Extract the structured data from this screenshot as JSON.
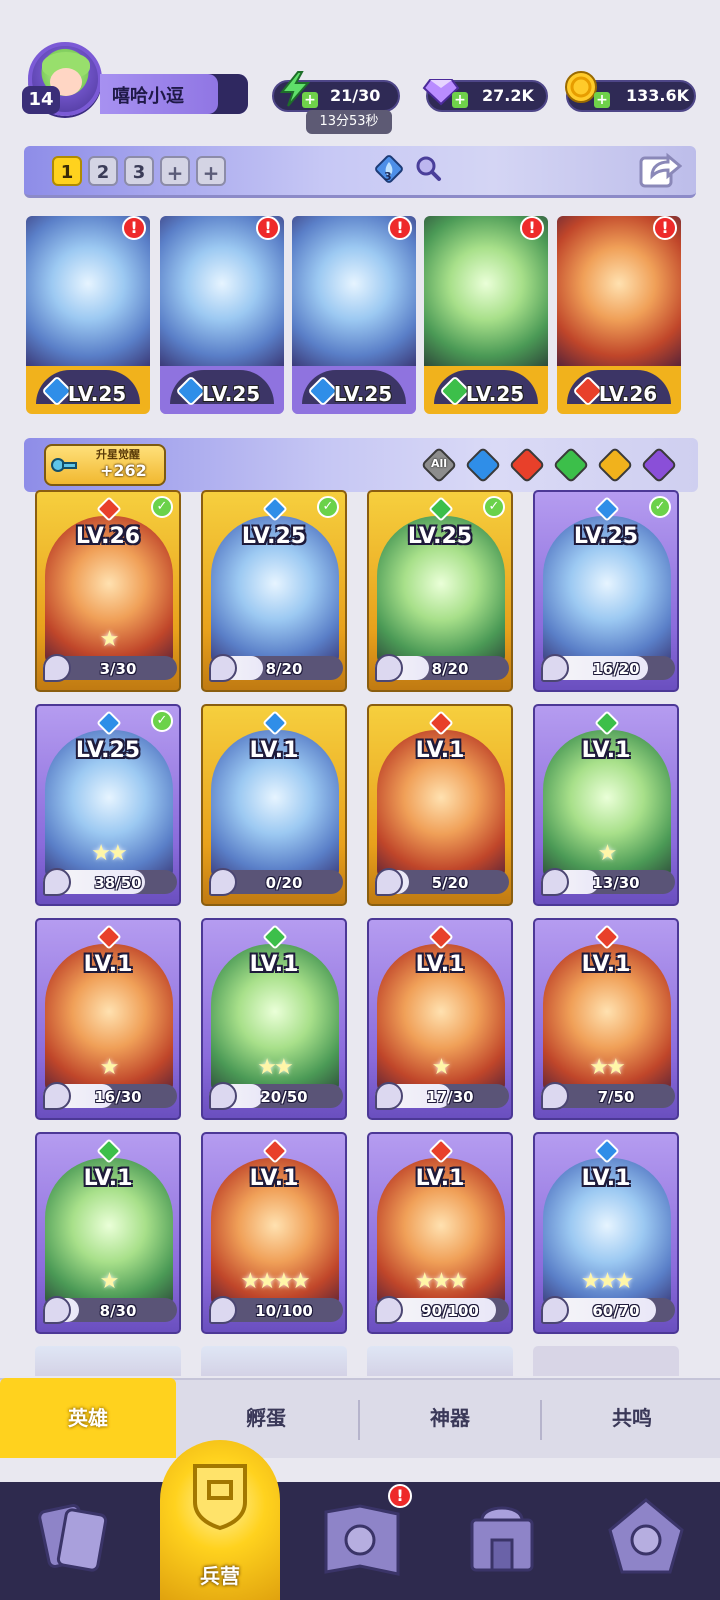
{
  "player": {
    "name": "嘻哈小逗",
    "level": "14"
  },
  "resources": {
    "energy": "21/30",
    "energy_timer": "13分53秒",
    "gems": "27.2K",
    "coins": "133.6K"
  },
  "team_tabs": [
    "1",
    "2",
    "3",
    "+",
    "+"
  ],
  "element_resonance_count": "3",
  "team": [
    {
      "level": "LV.25",
      "element": "water",
      "frame": "gold"
    },
    {
      "level": "LV.25",
      "element": "water",
      "frame": "purple"
    },
    {
      "level": "LV.25",
      "element": "water",
      "frame": "purple"
    },
    {
      "level": "LV.25",
      "element": "wind",
      "frame": "gold"
    },
    {
      "level": "LV.26",
      "element": "fire",
      "frame": "gold"
    }
  ],
  "awaken": {
    "title": "升星觉醒",
    "count": "+262"
  },
  "filters": [
    {
      "name": "all",
      "label": "All"
    },
    {
      "name": "water"
    },
    {
      "name": "fire"
    },
    {
      "name": "wind"
    },
    {
      "name": "light"
    },
    {
      "name": "dark"
    }
  ],
  "colors": {
    "water": "#2f8ee8",
    "fire": "#e8402a",
    "wind": "#3cbf4a",
    "light": "#f1b21c",
    "dark": "#8a4fd8"
  },
  "heroes": [
    {
      "level": "LV.26",
      "element": "fire",
      "frame": "gold",
      "stars": "★",
      "progress": "3/30",
      "checked": true
    },
    {
      "level": "LV.25",
      "element": "water",
      "frame": "gold",
      "stars": "",
      "progress": "8/20",
      "checked": true
    },
    {
      "level": "LV.25",
      "element": "wind",
      "frame": "gold",
      "stars": "",
      "progress": "8/20",
      "checked": true
    },
    {
      "level": "LV.25",
      "element": "water",
      "frame": "purple",
      "stars": "",
      "progress": "16/20",
      "checked": true
    },
    {
      "level": "LV.25",
      "element": "water",
      "frame": "purple",
      "stars": "★★",
      "progress": "38/50",
      "checked": true
    },
    {
      "level": "LV.1",
      "element": "water",
      "frame": "gold",
      "stars": "",
      "progress": "0/20",
      "checked": false
    },
    {
      "level": "LV.1",
      "element": "fire",
      "frame": "gold",
      "stars": "",
      "progress": "5/20",
      "checked": false
    },
    {
      "level": "LV.1",
      "element": "wind",
      "frame": "purple",
      "stars": "★",
      "progress": "13/30",
      "checked": false
    },
    {
      "level": "LV.1",
      "element": "fire",
      "frame": "purple",
      "stars": "★",
      "progress": "16/30",
      "checked": false
    },
    {
      "level": "LV.1",
      "element": "wind",
      "frame": "purple",
      "stars": "★★",
      "progress": "20/50",
      "checked": false
    },
    {
      "level": "LV.1",
      "element": "fire",
      "frame": "purple",
      "stars": "★",
      "progress": "17/30",
      "checked": false
    },
    {
      "level": "LV.1",
      "element": "fire",
      "frame": "purple",
      "stars": "★★",
      "progress": "7/50",
      "checked": false
    },
    {
      "level": "LV.1",
      "element": "wind",
      "frame": "purple",
      "stars": "★",
      "progress": "8/30",
      "checked": false
    },
    {
      "level": "LV.1",
      "element": "fire",
      "frame": "purple",
      "stars": "★★★★",
      "progress": "10/100",
      "checked": false
    },
    {
      "level": "LV.1",
      "element": "fire",
      "frame": "purple",
      "stars": "★★★",
      "progress": "90/100",
      "checked": false
    },
    {
      "level": "LV.1",
      "element": "water",
      "frame": "purple",
      "stars": "★★★",
      "progress": "60/70",
      "checked": false
    }
  ],
  "sub_tabs": [
    "英雄",
    "孵蛋",
    "神器",
    "共鸣"
  ],
  "nav": [
    {
      "name": "cards"
    },
    {
      "name": "barracks",
      "label": "兵营",
      "active": true
    },
    {
      "name": "map",
      "alert": "!"
    },
    {
      "name": "shrine"
    },
    {
      "name": "guild"
    }
  ]
}
